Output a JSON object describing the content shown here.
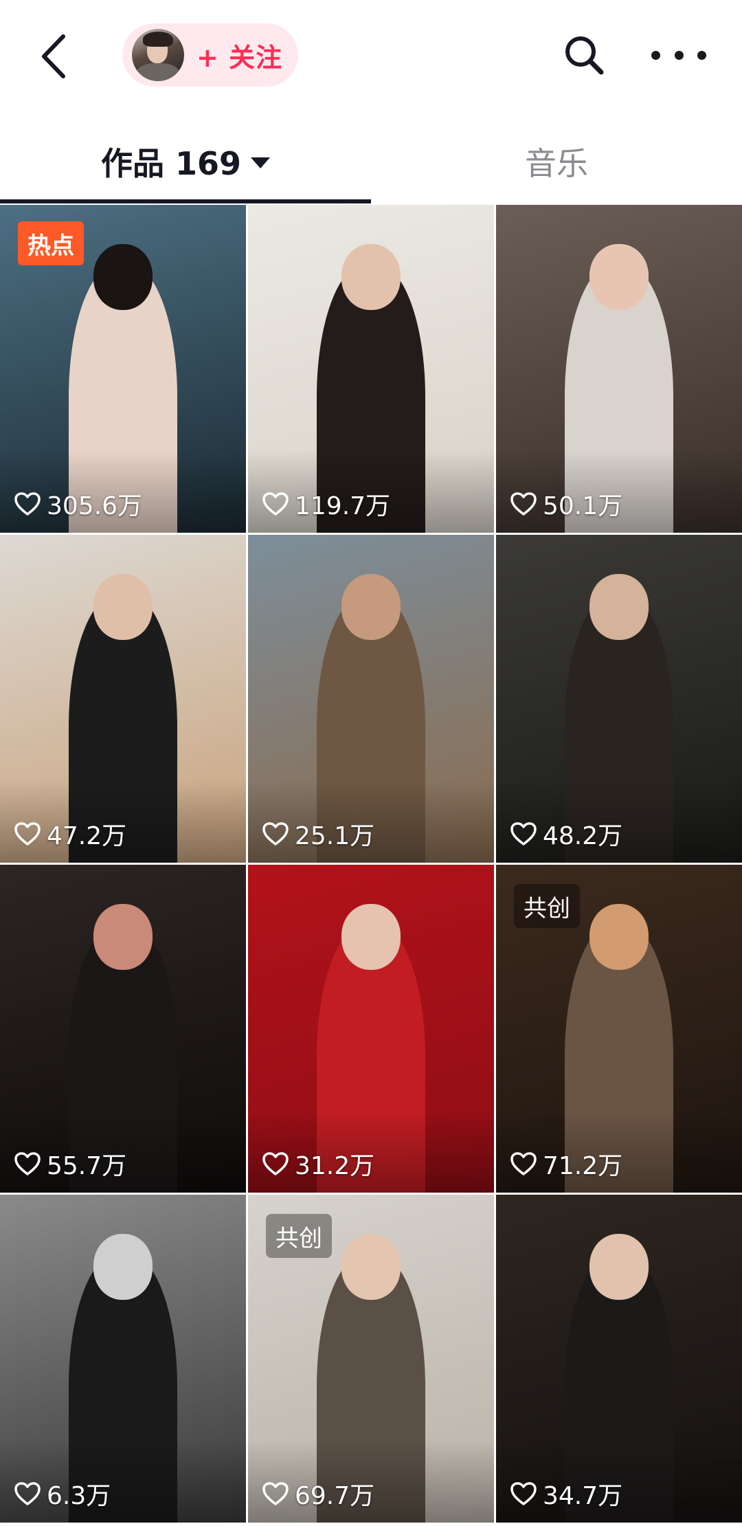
{
  "header": {
    "follow_label": "+ 关注"
  },
  "tabs": [
    {
      "label": "作品 169",
      "active": true
    },
    {
      "label": "音乐",
      "active": false
    }
  ],
  "videos": [
    {
      "likes": "305.6万",
      "badge": "热点",
      "badge_type": "hot",
      "palette": [
        "#4d7083",
        "#1b2a33",
        "#e8d3c8",
        "#1a1412"
      ]
    },
    {
      "likes": "119.7万",
      "badge": "",
      "badge_type": "",
      "palette": [
        "#ece9e4",
        "#d8d2c8",
        "#231c1a",
        "#e2c2ad"
      ]
    },
    {
      "likes": "50.1万",
      "badge": "",
      "badge_type": "",
      "palette": [
        "#6b5e56",
        "#3a2e28",
        "#d9d3ce",
        "#e8c5b3"
      ]
    },
    {
      "likes": "47.2万",
      "badge": "",
      "badge_type": "",
      "palette": [
        "#ddd9d3",
        "#c9a27c",
        "#1c1c1c",
        "#e0bfa8"
      ]
    },
    {
      "likes": "25.1万",
      "badge": "",
      "badge_type": "",
      "palette": [
        "#7d8e9a",
        "#8a6b4e",
        "#6e5843",
        "#c59a7f"
      ]
    },
    {
      "likes": "48.2万",
      "badge": "",
      "badge_type": "",
      "palette": [
        "#3b3a36",
        "#1a1a18",
        "#2a2420",
        "#d5b29a"
      ]
    },
    {
      "likes": "55.7万",
      "badge": "",
      "badge_type": "",
      "palette": [
        "#2c2523",
        "#0f0c0b",
        "#1a1716",
        "#c98a78"
      ]
    },
    {
      "likes": "31.2万",
      "badge": "",
      "badge_type": "",
      "palette": [
        "#b3121b",
        "#8e0d14",
        "#c21d23",
        "#e6c3ae"
      ]
    },
    {
      "likes": "71.2万",
      "badge": "共创",
      "badge_type": "collab",
      "palette": [
        "#3b2a1e",
        "#1e150f",
        "#6a5444",
        "#d29b70"
      ]
    },
    {
      "likes": "6.3万",
      "badge": "",
      "badge_type": "",
      "palette": [
        "#8a8a8a",
        "#3a3a3a",
        "#1a1a1a",
        "#cfcfcf"
      ]
    },
    {
      "likes": "69.7万",
      "badge": "共创",
      "badge_type": "collab",
      "palette": [
        "#d6d2cc",
        "#b9b2a8",
        "#5a5046",
        "#e4c6b0"
      ]
    },
    {
      "likes": "34.7万",
      "badge": "",
      "badge_type": "",
      "palette": [
        "#2e2620",
        "#141110",
        "#1c1a19",
        "#e0c2ae"
      ]
    }
  ],
  "colors": {
    "accent": "#fe2c55",
    "hot_badge": "#fe5a28",
    "text_primary": "#161823",
    "text_secondary": "#8a8a8f"
  }
}
